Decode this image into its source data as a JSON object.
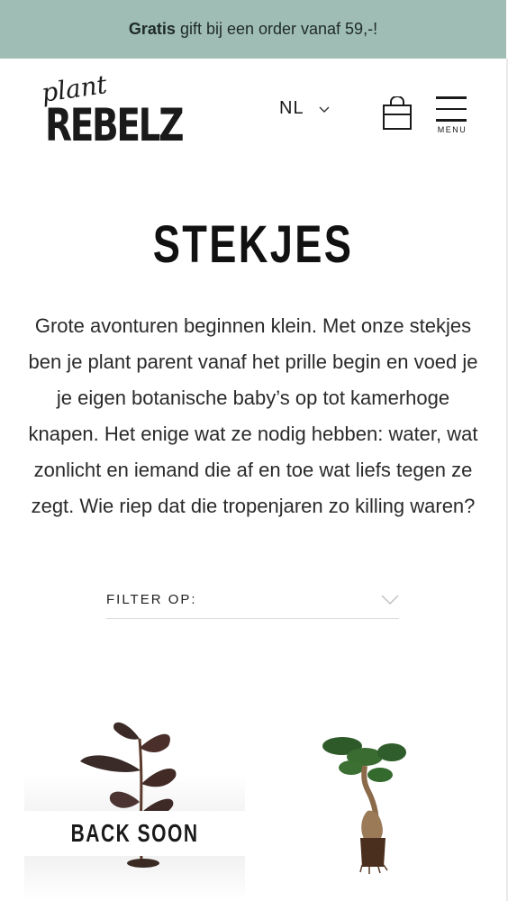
{
  "promo": {
    "bold": "Gratis",
    "text": "gift bij een order vanaf 59,-!"
  },
  "header": {
    "logo_top": "plant",
    "logo_main": "REBELZ",
    "language": "NL",
    "menu_label": "MENU"
  },
  "page": {
    "title": "STEKJES",
    "intro": "Grote avonturen beginnen klein. Met onze stekjes ben je plant parent vanaf het prille begin en voed je je eigen botanische baby’s op tot kamerhoge knapen. Het enige wat ze nodig hebben: water, wat zonlicht en iemand die af en toe wat liefs tegen ze zegt. Wie riep dat die tropenjaren zo killing waren?"
  },
  "filter": {
    "label": "FILTER OP:"
  },
  "products": [
    {
      "badge": "BACK SOON",
      "icon": "rubber-plant"
    },
    {
      "icon": "bonsai-ficus"
    }
  ],
  "colors": {
    "promo_bg": "#9fbdb5",
    "text": "#1a1a1a"
  }
}
